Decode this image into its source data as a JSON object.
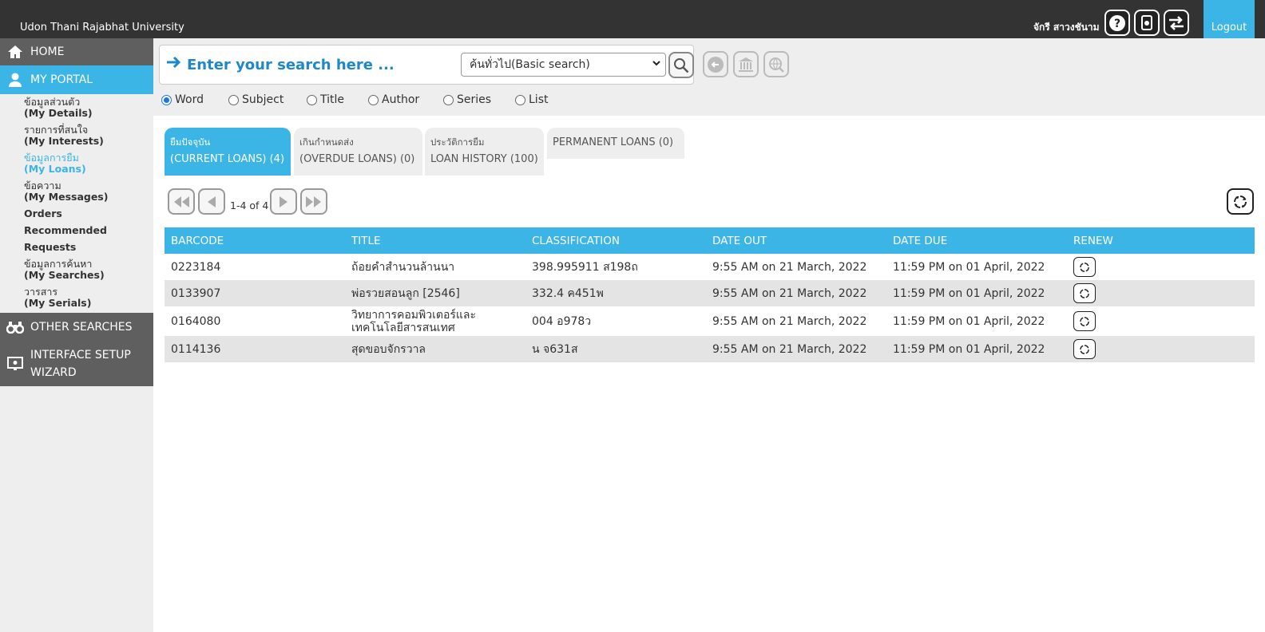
{
  "header": {
    "university": "Udon Thani Rajabhat University",
    "user_name": "จักรี สาวงชันาม",
    "logout_label": "Logout",
    "icons": [
      "help-icon",
      "settings-icon",
      "switch-icon"
    ]
  },
  "sidebar": {
    "home": "HOME",
    "my_portal": "MY PORTAL",
    "sub_items": [
      {
        "th": "ข้อมูลส่วนตัว",
        "en": "(My Details)"
      },
      {
        "th": "รายการที่สนใจ",
        "en": "(My Interests)"
      },
      {
        "th": "ข้อมูลการยืม",
        "en": "(My Loans)"
      },
      {
        "th": "ข้อความ",
        "en": "(My Messages)"
      },
      {
        "th": "",
        "en": "Orders"
      },
      {
        "th": "",
        "en": "Recommended"
      },
      {
        "th": "",
        "en": "Requests"
      },
      {
        "th": "ข้อมูลการค้นหา",
        "en": "(My Searches)"
      },
      {
        "th": "วารสาร",
        "en": "(My Serials)"
      }
    ],
    "other_searches": "OTHER SEARCHES",
    "wizard_line1": "INTERFACE SETUP",
    "wizard_line2": "WIZARD"
  },
  "search": {
    "placeholder": "Enter your search here ...",
    "mode_selected": "ค้นทั่วไป(Basic search)",
    "radio_options": [
      "Word",
      "Subject",
      "Title",
      "Author",
      "Series",
      "List"
    ],
    "radio_selected": "Word"
  },
  "tabs": [
    {
      "th": "ยืมปัจจุบัน",
      "en": "(CURRENT LOANS) (4)"
    },
    {
      "th": "เกินกำหนดส่ง",
      "en": "(OVERDUE LOANS) (0)"
    },
    {
      "th": "ประวัติการยืม",
      "en": "LOAN HISTORY (100)"
    },
    {
      "th": "",
      "en": "PERMANENT LOANS (0)"
    }
  ],
  "pager": {
    "text": "1-4 of 4"
  },
  "table": {
    "headers": [
      "BARCODE",
      "TITLE",
      "CLASSIFICATION",
      "DATE OUT",
      "DATE DUE",
      "RENEW"
    ],
    "rows": [
      {
        "barcode": "0223184",
        "title": "ถ้อยคำสำนวนล้านนา",
        "classification": "398.995911 ส198ถ",
        "date_out": "9:55 AM on 21 March, 2022",
        "date_due": "11:59 PM on 01 April, 2022"
      },
      {
        "barcode": "0133907",
        "title": "พ่อรวยสอนลูก [2546]",
        "classification": "332.4 ค451พ",
        "date_out": "9:55 AM on 21 March, 2022",
        "date_due": "11:59 PM on 01 April, 2022"
      },
      {
        "barcode": "0164080",
        "title": "วิทยาการคอมพิวเตอร์และเทคโนโลยีสารสนเทศ",
        "classification": "004 อ978ว",
        "date_out": "9:55 AM on 21 March, 2022",
        "date_due": "11:59 PM on 01 April, 2022"
      },
      {
        "barcode": "0114136",
        "title": "สุดขอบจักรวาล",
        "classification": "น จ631ส",
        "date_out": "9:55 AM on 21 March, 2022",
        "date_due": "11:59 PM on 01 April, 2022"
      }
    ]
  },
  "colors": {
    "accent": "#3bb5e5",
    "topbar": "#333333",
    "sidebar_dark": "#5f5f5f",
    "link_blue": "#1e88c9"
  }
}
